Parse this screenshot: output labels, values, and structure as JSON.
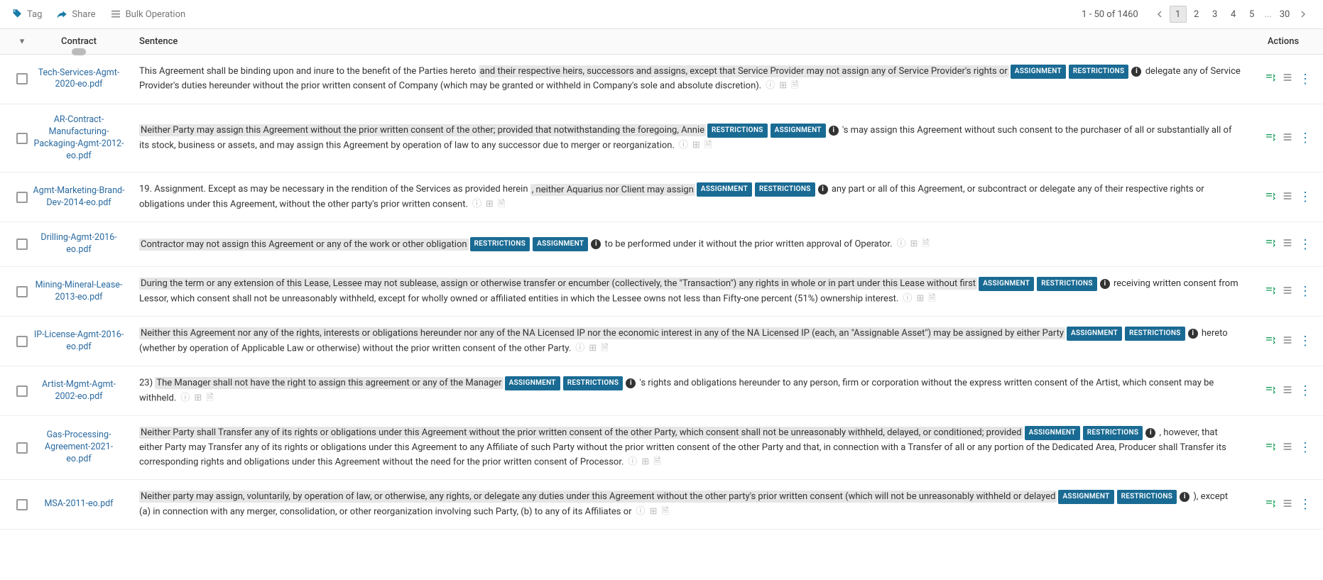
{
  "toolbar": {
    "tag": "Tag",
    "share": "Share",
    "bulk": "Bulk Operation"
  },
  "pagination": {
    "range": "1 - 50 of 1460",
    "pages": [
      "1",
      "2",
      "3",
      "4",
      "5"
    ],
    "ellipsis": "...",
    "last": "30",
    "active": "1"
  },
  "headers": {
    "contract": "Contract",
    "sentence": "Sentence",
    "actions": "Actions"
  },
  "badges": {
    "assignment": "ASSIGNMENT",
    "restrictions": "RESTRICTIONS"
  },
  "rows": [
    {
      "contract": "Tech-Services-Agmt-2020-eo.pdf",
      "parts": [
        {
          "t": "text",
          "v": "This Agreement shall be binding upon and inure to the benefit of the Parties hereto "
        },
        {
          "t": "hl",
          "v": "and their respective heirs, successors and assigns, except that Service Provider may not assign any of Service Provider's rights or"
        },
        {
          "t": "badge",
          "v": "assignment"
        },
        {
          "t": "badge",
          "v": "restrictions"
        },
        {
          "t": "info"
        },
        {
          "t": "text",
          "v": " delegate any of Service Provider's duties hereunder without the prior written consent of Company (which may be granted or withheld in Company's sole and absolute discretion)."
        },
        {
          "t": "trail"
        }
      ]
    },
    {
      "contract": "AR-Contract-Manufacturing-Packaging-Agmt-2012-eo.pdf",
      "parts": [
        {
          "t": "hl",
          "v": "Neither Party may assign this Agreement without the prior written consent of the other; provided that notwithstanding the foregoing, Annie"
        },
        {
          "t": "badge",
          "v": "restrictions"
        },
        {
          "t": "badge",
          "v": "assignment"
        },
        {
          "t": "info"
        },
        {
          "t": "text",
          "v": " 's may assign this Agreement without such consent to the purchaser of all or substantially all of its stock, business or assets, and may assign this Agreement by operation of law to any successor due to merger or reorganization."
        },
        {
          "t": "trail"
        }
      ]
    },
    {
      "contract": "Agmt-Marketing-Brand-Dev-2014-eo.pdf",
      "parts": [
        {
          "t": "text",
          "v": "19. Assignment. Except as may be necessary in the rendition of the Services as provided herein "
        },
        {
          "t": "hl",
          "v": ", neither Aquarius nor Client may assign"
        },
        {
          "t": "badge",
          "v": "assignment"
        },
        {
          "t": "badge",
          "v": "restrictions"
        },
        {
          "t": "info"
        },
        {
          "t": "text",
          "v": " any part or all of this Agreement, or subcontract or delegate any of their respective rights or obligations under this Agreement, without the other party's prior written consent."
        },
        {
          "t": "trail"
        }
      ]
    },
    {
      "contract": "Drilling-Agmt-2016-eo.pdf",
      "parts": [
        {
          "t": "hl",
          "v": "Contractor may not assign this Agreement or any of the work or other obligation"
        },
        {
          "t": "badge",
          "v": "restrictions"
        },
        {
          "t": "badge",
          "v": "assignment"
        },
        {
          "t": "info"
        },
        {
          "t": "text",
          "v": " to be performed under it without the prior written approval of Operator."
        },
        {
          "t": "trail"
        }
      ]
    },
    {
      "contract": "Mining-Mineral-Lease-2013-eo.pdf",
      "parts": [
        {
          "t": "hl",
          "v": "During the term or any extension of this Lease, Lessee may not sublease, assign or otherwise transfer or encumber (collectively, the \"Transaction\") any rights in whole or in part under this Lease without first"
        },
        {
          "t": "badge",
          "v": "assignment"
        },
        {
          "t": "badge",
          "v": "restrictions"
        },
        {
          "t": "info"
        },
        {
          "t": "text",
          "v": " receiving written consent from Lessor, which consent shall not be unreasonably withheld, except for wholly owned or affiliated entities in which the Lessee owns not less than Fifty-one percent (51%) ownership interest."
        },
        {
          "t": "trail"
        }
      ]
    },
    {
      "contract": "IP-License-Agmt-2016-eo.pdf",
      "parts": [
        {
          "t": "hl",
          "v": "Neither this Agreement nor any of the rights, interests or obligations hereunder nor any of the NA Licensed IP nor the economic interest in any of the NA Licensed IP (each, an \"Assignable Asset\") may be assigned by either Party"
        },
        {
          "t": "badge",
          "v": "assignment"
        },
        {
          "t": "badge",
          "v": "restrictions"
        },
        {
          "t": "info"
        },
        {
          "t": "text",
          "v": " hereto (whether by operation of Applicable Law or otherwise) without the prior written consent of the other Party."
        },
        {
          "t": "trail"
        }
      ]
    },
    {
      "contract": "Artist-Mgmt-Agmt-2002-eo.pdf",
      "parts": [
        {
          "t": "text",
          "v": "23) "
        },
        {
          "t": "hl",
          "v": "The Manager shall not have the right to assign this agreement or any of the Manager"
        },
        {
          "t": "badge",
          "v": "assignment"
        },
        {
          "t": "badge",
          "v": "restrictions"
        },
        {
          "t": "info"
        },
        {
          "t": "text",
          "v": " 's rights and obligations hereunder to any person, firm or corporation without the express written consent of the Artist, which consent may be withheld."
        },
        {
          "t": "trail"
        }
      ]
    },
    {
      "contract": "Gas-Processing-Agreement-2021-eo.pdf",
      "parts": [
        {
          "t": "hl",
          "v": "Neither Party shall Transfer any of its rights or obligations under this Agreement without the prior written consent of the other Party, which consent shall not be unreasonably withheld, delayed, or conditioned; provided"
        },
        {
          "t": "badge",
          "v": "assignment"
        },
        {
          "t": "badge",
          "v": "restrictions"
        },
        {
          "t": "info"
        },
        {
          "t": "text",
          "v": " , however, that either Party may Transfer any of its rights or obligations under this Agreement to any Affiliate of such Party without the prior written consent of the other Party and that, in connection with a Transfer of all or any portion of the Dedicated Area, Producer shall Transfer its corresponding rights and obligations under this Agreement without the need for the prior written consent of Processor."
        },
        {
          "t": "trail"
        }
      ]
    },
    {
      "contract": "MSA-2011-eo.pdf",
      "parts": [
        {
          "t": "hl",
          "v": "Neither party may assign, voluntarily, by operation of law, or otherwise, any rights, or delegate any duties under this Agreement without the other party's prior written consent (which will not be unreasonably withheld or delayed"
        },
        {
          "t": "badge",
          "v": "assignment"
        },
        {
          "t": "badge",
          "v": "restrictions"
        },
        {
          "t": "info"
        },
        {
          "t": "text",
          "v": " ), except (a) in connection with any merger, consolidation, or other reorganization involving such Party, (b) to any of its Affiliates or"
        },
        {
          "t": "trail"
        }
      ]
    }
  ]
}
